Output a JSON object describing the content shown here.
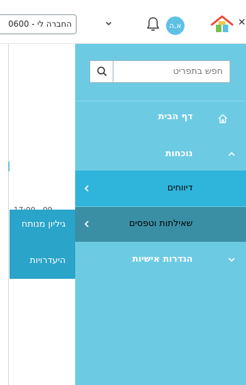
{
  "header": {
    "company_select_value": "0600 - החברה לי",
    "avatar_initials": "א.ה",
    "close_symbol": "✕"
  },
  "background": {
    "time_text": "17:00 - 09"
  },
  "submenu": {
    "items": [
      {
        "label": "גיליון מנותח"
      },
      {
        "label": "היעדרויות"
      }
    ]
  },
  "drawer": {
    "search_placeholder": "חפש בתפריט",
    "items": [
      {
        "label": "דף הבית",
        "icon": "home-icon"
      },
      {
        "label": "נוכחות",
        "icon": "chevron-up-icon"
      },
      {
        "label": "דיווחים",
        "icon": "chevron-left-icon"
      },
      {
        "label": "שאילתות וטפסים",
        "icon": "chevron-left-icon"
      },
      {
        "label": "הגדרות אישיות",
        "icon": "chevron-down-icon"
      }
    ]
  },
  "colors": {
    "drawer_bg": "#6ccbe3",
    "highlight": "#2fb4db",
    "selected": "#3b8fa5",
    "accent": "#5ec1e4",
    "submenu_bg": "#2aa4c9"
  }
}
